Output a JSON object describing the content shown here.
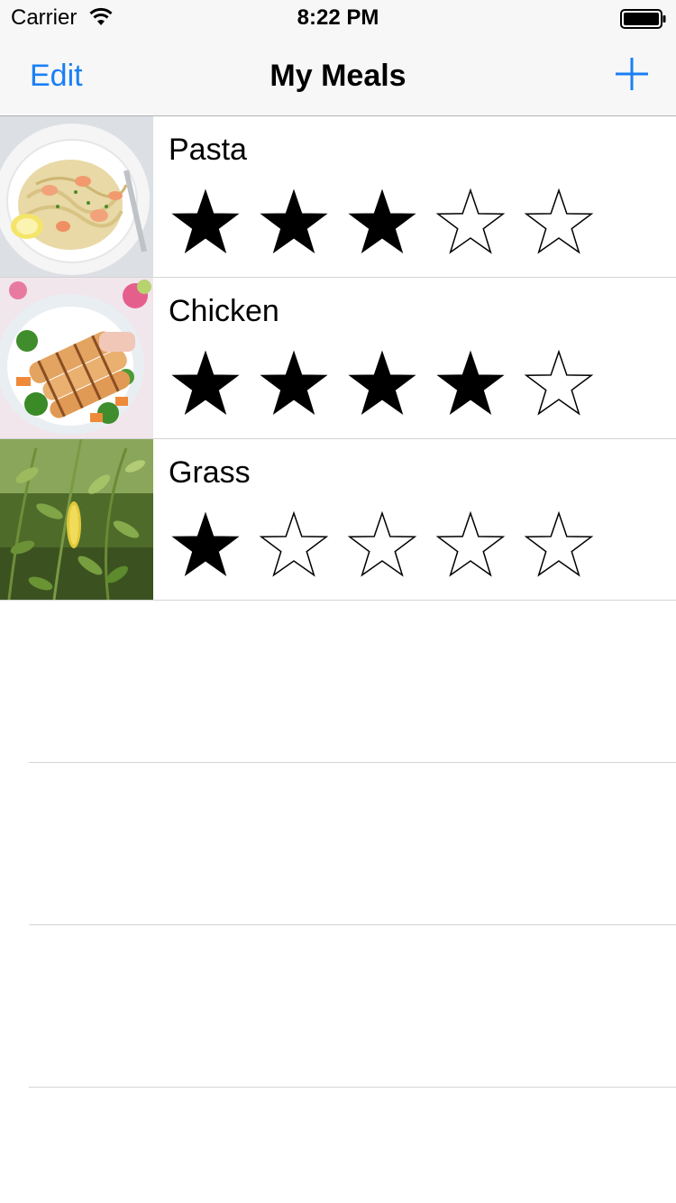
{
  "status_bar": {
    "carrier": "Carrier",
    "time": "8:22 PM",
    "icons": [
      "wifi-icon",
      "battery-icon"
    ]
  },
  "nav": {
    "left_button": "Edit",
    "title": "My Meals",
    "right_icon": "plus-icon"
  },
  "colors": {
    "accent": "#1a7ff5",
    "bar_background": "#f7f7f7",
    "separator": "#d4d4d4"
  },
  "meals": [
    {
      "name": "Pasta",
      "rating": 3,
      "max_rating": 5,
      "photo": "pasta-photo"
    },
    {
      "name": "Chicken",
      "rating": 4,
      "max_rating": 5,
      "photo": "chicken-photo"
    },
    {
      "name": "Grass",
      "rating": 1,
      "max_rating": 5,
      "photo": "grass-photo"
    }
  ]
}
